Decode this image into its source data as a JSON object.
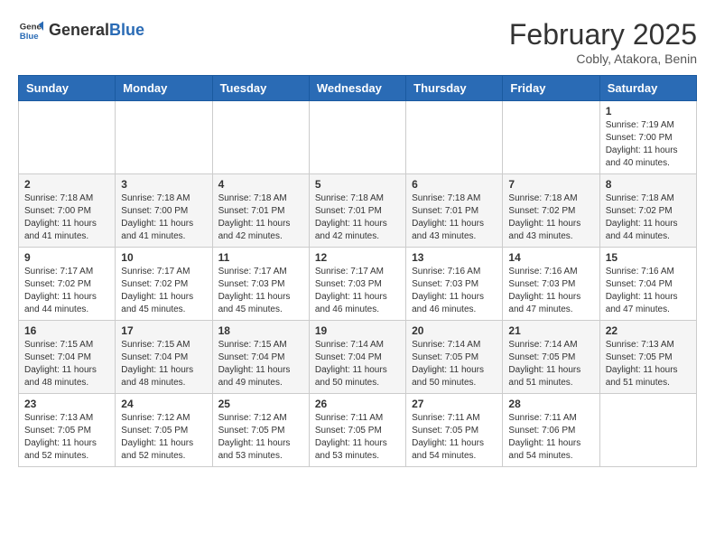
{
  "header": {
    "logo_general": "General",
    "logo_blue": "Blue",
    "month_year": "February 2025",
    "location": "Cobly, Atakora, Benin"
  },
  "days_of_week": [
    "Sunday",
    "Monday",
    "Tuesday",
    "Wednesday",
    "Thursday",
    "Friday",
    "Saturday"
  ],
  "weeks": [
    [
      {
        "day": "",
        "info": ""
      },
      {
        "day": "",
        "info": ""
      },
      {
        "day": "",
        "info": ""
      },
      {
        "day": "",
        "info": ""
      },
      {
        "day": "",
        "info": ""
      },
      {
        "day": "",
        "info": ""
      },
      {
        "day": "1",
        "info": "Sunrise: 7:19 AM\nSunset: 7:00 PM\nDaylight: 11 hours\nand 40 minutes."
      }
    ],
    [
      {
        "day": "2",
        "info": "Sunrise: 7:18 AM\nSunset: 7:00 PM\nDaylight: 11 hours\nand 41 minutes."
      },
      {
        "day": "3",
        "info": "Sunrise: 7:18 AM\nSunset: 7:00 PM\nDaylight: 11 hours\nand 41 minutes."
      },
      {
        "day": "4",
        "info": "Sunrise: 7:18 AM\nSunset: 7:01 PM\nDaylight: 11 hours\nand 42 minutes."
      },
      {
        "day": "5",
        "info": "Sunrise: 7:18 AM\nSunset: 7:01 PM\nDaylight: 11 hours\nand 42 minutes."
      },
      {
        "day": "6",
        "info": "Sunrise: 7:18 AM\nSunset: 7:01 PM\nDaylight: 11 hours\nand 43 minutes."
      },
      {
        "day": "7",
        "info": "Sunrise: 7:18 AM\nSunset: 7:02 PM\nDaylight: 11 hours\nand 43 minutes."
      },
      {
        "day": "8",
        "info": "Sunrise: 7:18 AM\nSunset: 7:02 PM\nDaylight: 11 hours\nand 44 minutes."
      }
    ],
    [
      {
        "day": "9",
        "info": "Sunrise: 7:17 AM\nSunset: 7:02 PM\nDaylight: 11 hours\nand 44 minutes."
      },
      {
        "day": "10",
        "info": "Sunrise: 7:17 AM\nSunset: 7:02 PM\nDaylight: 11 hours\nand 45 minutes."
      },
      {
        "day": "11",
        "info": "Sunrise: 7:17 AM\nSunset: 7:03 PM\nDaylight: 11 hours\nand 45 minutes."
      },
      {
        "day": "12",
        "info": "Sunrise: 7:17 AM\nSunset: 7:03 PM\nDaylight: 11 hours\nand 46 minutes."
      },
      {
        "day": "13",
        "info": "Sunrise: 7:16 AM\nSunset: 7:03 PM\nDaylight: 11 hours\nand 46 minutes."
      },
      {
        "day": "14",
        "info": "Sunrise: 7:16 AM\nSunset: 7:03 PM\nDaylight: 11 hours\nand 47 minutes."
      },
      {
        "day": "15",
        "info": "Sunrise: 7:16 AM\nSunset: 7:04 PM\nDaylight: 11 hours\nand 47 minutes."
      }
    ],
    [
      {
        "day": "16",
        "info": "Sunrise: 7:15 AM\nSunset: 7:04 PM\nDaylight: 11 hours\nand 48 minutes."
      },
      {
        "day": "17",
        "info": "Sunrise: 7:15 AM\nSunset: 7:04 PM\nDaylight: 11 hours\nand 48 minutes."
      },
      {
        "day": "18",
        "info": "Sunrise: 7:15 AM\nSunset: 7:04 PM\nDaylight: 11 hours\nand 49 minutes."
      },
      {
        "day": "19",
        "info": "Sunrise: 7:14 AM\nSunset: 7:04 PM\nDaylight: 11 hours\nand 50 minutes."
      },
      {
        "day": "20",
        "info": "Sunrise: 7:14 AM\nSunset: 7:05 PM\nDaylight: 11 hours\nand 50 minutes."
      },
      {
        "day": "21",
        "info": "Sunrise: 7:14 AM\nSunset: 7:05 PM\nDaylight: 11 hours\nand 51 minutes."
      },
      {
        "day": "22",
        "info": "Sunrise: 7:13 AM\nSunset: 7:05 PM\nDaylight: 11 hours\nand 51 minutes."
      }
    ],
    [
      {
        "day": "23",
        "info": "Sunrise: 7:13 AM\nSunset: 7:05 PM\nDaylight: 11 hours\nand 52 minutes."
      },
      {
        "day": "24",
        "info": "Sunrise: 7:12 AM\nSunset: 7:05 PM\nDaylight: 11 hours\nand 52 minutes."
      },
      {
        "day": "25",
        "info": "Sunrise: 7:12 AM\nSunset: 7:05 PM\nDaylight: 11 hours\nand 53 minutes."
      },
      {
        "day": "26",
        "info": "Sunrise: 7:11 AM\nSunset: 7:05 PM\nDaylight: 11 hours\nand 53 minutes."
      },
      {
        "day": "27",
        "info": "Sunrise: 7:11 AM\nSunset: 7:05 PM\nDaylight: 11 hours\nand 54 minutes."
      },
      {
        "day": "28",
        "info": "Sunrise: 7:11 AM\nSunset: 7:06 PM\nDaylight: 11 hours\nand 54 minutes."
      },
      {
        "day": "",
        "info": ""
      }
    ]
  ]
}
